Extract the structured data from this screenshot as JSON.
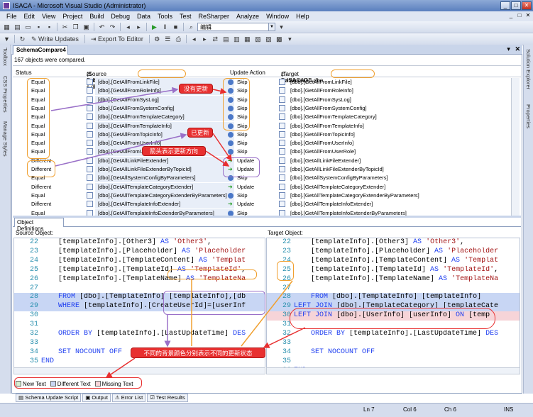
{
  "window": {
    "title": "ISACA - Microsoft Visual Studio (Administrator)",
    "min": "_",
    "max": "□",
    "close": "✕"
  },
  "menu": [
    "File",
    "Edit",
    "View",
    "Project",
    "Build",
    "Debug",
    "Data",
    "Tools",
    "Test",
    "ReSharper",
    "Analyze",
    "Window",
    "Help"
  ],
  "toolbar1": {
    "combo_value": "编辑"
  },
  "toolbar2": {
    "write_updates": "Write Updates",
    "export_to_editor": "Export To Editor"
  },
  "left_strip": {
    "toolbox": "Toolbox",
    "css_properties": "CSS Properties",
    "manage_styles": "Manage Styles"
  },
  "right_strip": {
    "solution_explorer": "Solution Explorer",
    "properties": "Properties"
  },
  "doc_tab": {
    "label": "SchemaCompare4",
    "pin": "▾",
    "close": "✕"
  },
  "info_bar": "167 objects were compared.",
  "grid": {
    "headers": {
      "status": "Status",
      "source": "zt-pcISACADB-s.dbo",
      "source_tag": "(Source Database)",
      "action": "Update Action",
      "target": "zt-pcISACADB.dbo",
      "target_tag": "(Target Database)"
    },
    "rows": [
      {
        "status": "Equal",
        "source": "[dbo].[GetAllFromLinkFile]",
        "action": "Skip",
        "target": "[dbo].[GetAllFromLinkFile]"
      },
      {
        "status": "Equal",
        "source": "[dbo].[GetAllFromRoleInfo]",
        "action": "Skip",
        "target": "[dbo].[GetAllFromRoleInfo]"
      },
      {
        "status": "Equal",
        "source": "[dbo].[GetAllFromSysLog]",
        "action": "Skip",
        "target": "[dbo].[GetAllFromSysLog]"
      },
      {
        "status": "Equal",
        "source": "[dbo].[GetAllFromSystemConfig]",
        "action": "Skip",
        "target": "[dbo].[GetAllFromSystemConfig]"
      },
      {
        "status": "Equal",
        "source": "[dbo].[GetAllFromTemplateCategory]",
        "action": "Skip",
        "target": "[dbo].[GetAllFromTemplateCategory]"
      },
      {
        "status": "Equal",
        "source": "[dbo].[GetAllFromTemplateInfo]",
        "action": "Skip",
        "target": "[dbo].[GetAllFromTemplateInfo]"
      },
      {
        "status": "Equal",
        "source": "[dbo].[GetAllFromTopicInfo]",
        "action": "Skip",
        "target": "[dbo].[GetAllFromTopicInfo]"
      },
      {
        "status": "Equal",
        "source": "[dbo].[GetAllFromUserInfo]",
        "action": "Skip",
        "target": "[dbo].[GetAllFromUserInfo]"
      },
      {
        "status": "Equal",
        "source": "[dbo].[GetAllFromUserRole]",
        "action": "Skip",
        "target": "[dbo].[GetAllFromUserRole]"
      },
      {
        "status": "Different",
        "source": "[dbo].[GetAllLinkFileExtender]",
        "action": "Update",
        "target": "[dbo].[GetAllLinkFileExtender]"
      },
      {
        "status": "Different",
        "source": "[dbo].[GetAllLinkFileExtenderByTopicId]",
        "action": "Update",
        "target": "[dbo].[GetAllLinkFileExtenderByTopicId]"
      },
      {
        "status": "Equal",
        "source": "[dbo].[GetAllSystemConfigByParameters]",
        "action": "Skip",
        "target": "[dbo].[GetAllSystemConfigByParameters]"
      },
      {
        "status": "Different",
        "source": "[dbo].[GetAllTemplateCategoryExtender]",
        "action": "Update",
        "target": "[dbo].[GetAllTemplateCategoryExtender]"
      },
      {
        "status": "Equal",
        "source": "[dbo].[GetAllTemplateCategoryExtenderByParameters]",
        "action": "Skip",
        "target": "[dbo].[GetAllTemplateCategoryExtenderByParameters]"
      },
      {
        "status": "Different",
        "source": "[dbo].[GetAllTemplateInfoExtender]",
        "action": "Update",
        "target": "[dbo].[GetAllTemplateInfoExtender]"
      },
      {
        "status": "Equal",
        "source": "[dbo].[GetAllTemplateInfoExtenderByParameters]",
        "action": "Skip",
        "target": "[dbo].[GetAllTemplateInfoExtenderByParameters]"
      }
    ]
  },
  "object_definitions": {
    "tab": "Object Definitions",
    "source_label": "Source Object:",
    "target_label": "Target Object:"
  },
  "source_code": [
    {
      "n": "22",
      "t": "    [templateInfo].[Other3] AS 'Other3',"
    },
    {
      "n": "23",
      "t": "    [templateInfo].[Placeholder] AS 'Placeholder"
    },
    {
      "n": "24",
      "t": "    [templateInfo].[TemplateContent] AS 'Templat"
    },
    {
      "n": "25",
      "t": "    [templateInfo].[TemplateId] AS 'TemplateId',"
    },
    {
      "n": "26",
      "t": "    [templateInfo].[TemplateName] AS 'TemplateNa"
    },
    {
      "n": "27",
      "t": ""
    },
    {
      "n": "28",
      "t": "    FROM [dbo].[TemplateInfo] [templateInfo],[db"
    },
    {
      "n": "29",
      "t": "    WHERE [templateInfo].[CreateUserId]=[userInf"
    },
    {
      "n": "30",
      "t": ""
    },
    {
      "n": "31",
      "t": ""
    },
    {
      "n": "32",
      "t": "    ORDER BY [templateInfo].[LastUpdateTime] DES"
    },
    {
      "n": "33",
      "t": ""
    },
    {
      "n": "34",
      "t": "    SET NOCOUNT OFF"
    },
    {
      "n": "35",
      "t": "END"
    }
  ],
  "target_code": [
    {
      "n": "22",
      "t": "    [templateInfo].[Other3] AS 'Other3',"
    },
    {
      "n": "23",
      "t": "    [templateInfo].[Placeholder] AS 'Placeholder"
    },
    {
      "n": "24",
      "t": "    [templateInfo].[TemplateContent] AS 'Templat"
    },
    {
      "n": "25",
      "t": "    [templateInfo].[TemplateId] AS 'TemplateId',"
    },
    {
      "n": "26",
      "t": "    [templateInfo].[TemplateName] AS 'TemplateNa"
    },
    {
      "n": "27",
      "t": ""
    },
    {
      "n": "28",
      "t": "    FROM [dbo].[TemplateInfo] [templateInfo]"
    },
    {
      "n": "29",
      "t": "LEFT JOIN [dbo].[TemplateCategory] [templateCate"
    },
    {
      "n": "30",
      "t": "LEFT JOIN [dbo].[UserInfo] [userInfo] ON [temp"
    },
    {
      "n": "31",
      "t": ""
    },
    {
      "n": "32",
      "t": "    ORDER BY [templateInfo].[LastUpdateTime] DES"
    },
    {
      "n": "33",
      "t": ""
    },
    {
      "n": "34",
      "t": "    SET NOCOUNT OFF"
    },
    {
      "n": "35",
      "t": ""
    },
    {
      "n": "36",
      "t": "END"
    }
  ],
  "legend": {
    "new_text": "New Text",
    "different_text": "Different Text",
    "missing_text": "Missing Text"
  },
  "bottom_tabs": [
    "Schema Update Script",
    "Output",
    "Error List",
    "Test Results"
  ],
  "statusbar": {
    "ln": "Ln 7",
    "col": "Col 6",
    "ch": "Ch 6",
    "ins": "INS"
  },
  "annotations": {
    "no_update": "没有更新",
    "updated": "已更新",
    "arrow_direction": "箭头表示更新方向",
    "bg_color_note": "不同的背景颜色分别表示不同的更新状态"
  },
  "colors": {
    "accent": "#4b78c8",
    "callout": "#e83030",
    "highlight_box": "#f0a030",
    "diff_blue": "#c8d6f4",
    "missing_pink": "#f6d4d8"
  }
}
